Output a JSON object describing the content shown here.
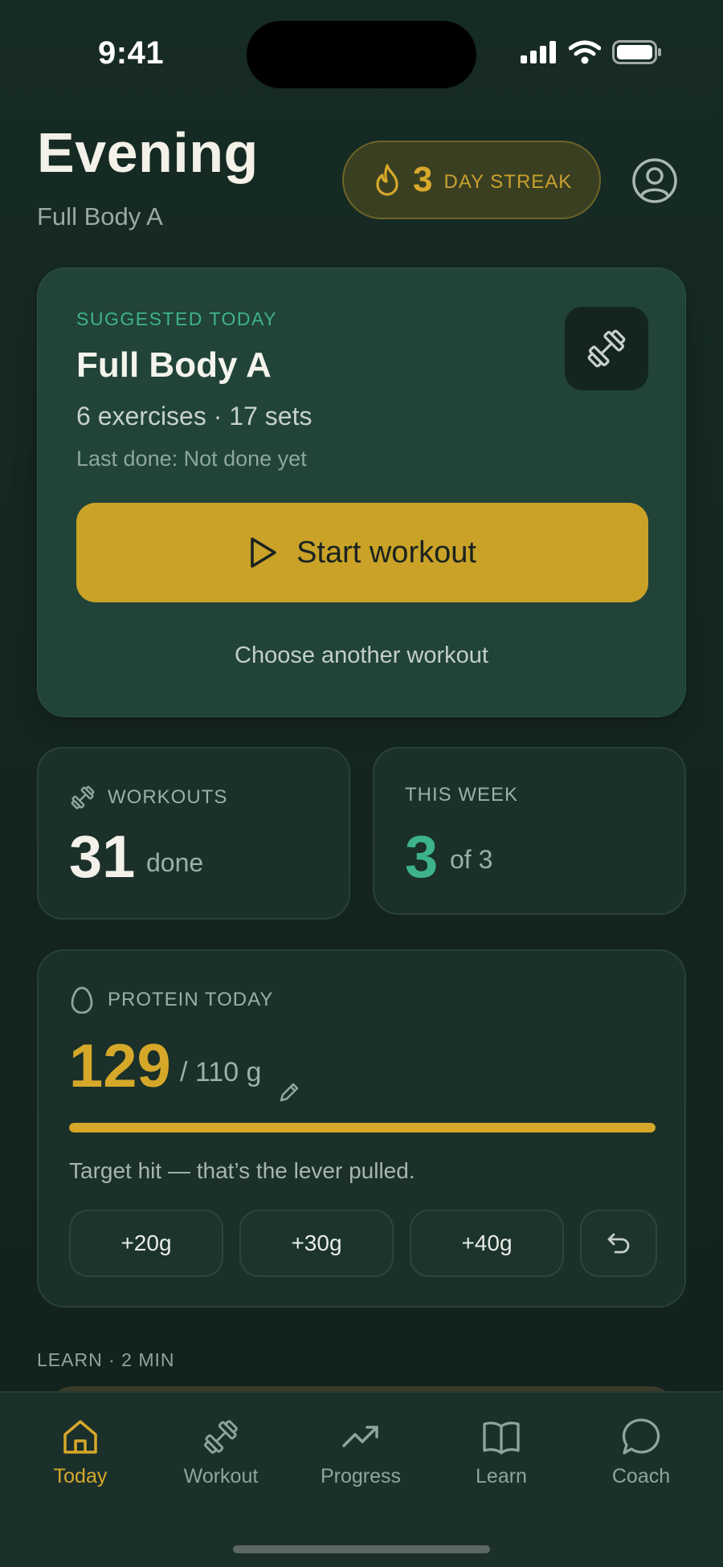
{
  "status_bar": {
    "time": "9:41"
  },
  "header": {
    "greeting": "Evening",
    "subtitle": "Full Body A",
    "streak": {
      "count": "3",
      "label": "DAY STREAK"
    }
  },
  "suggested": {
    "eyebrow": "SUGGESTED TODAY",
    "title": "Full Body A",
    "meta": "6 exercises · 17 sets",
    "last_done": "Last done: Not done yet",
    "start_label": "Start workout",
    "choose_label": "Choose another workout"
  },
  "stats": {
    "workouts": {
      "label": "WORKOUTS",
      "value": "31",
      "unit": "done"
    },
    "this_week": {
      "label": "THIS WEEK",
      "value": "3",
      "unit": "of 3"
    }
  },
  "protein": {
    "label": "PROTEIN TODAY",
    "value": "129",
    "target": "/ 110 g",
    "progress_fraction": 1.0,
    "message": "Target hit — that’s the lever pulled.",
    "quick_add": [
      "+20g",
      "+30g",
      "+40g"
    ]
  },
  "learn": {
    "label": "LEARN · 2 MIN"
  },
  "tabs": [
    {
      "label": "Today",
      "icon": "home-icon",
      "active": true
    },
    {
      "label": "Workout",
      "icon": "dumbbell-icon",
      "active": false
    },
    {
      "label": "Progress",
      "icon": "trending-up-icon",
      "active": false
    },
    {
      "label": "Learn",
      "icon": "book-icon",
      "active": false
    },
    {
      "label": "Coach",
      "icon": "chat-bubble-icon",
      "active": false
    }
  ],
  "colors": {
    "accent": "#c9a227",
    "green": "#3eb38a",
    "background": "#13241f",
    "card": "#214338"
  }
}
